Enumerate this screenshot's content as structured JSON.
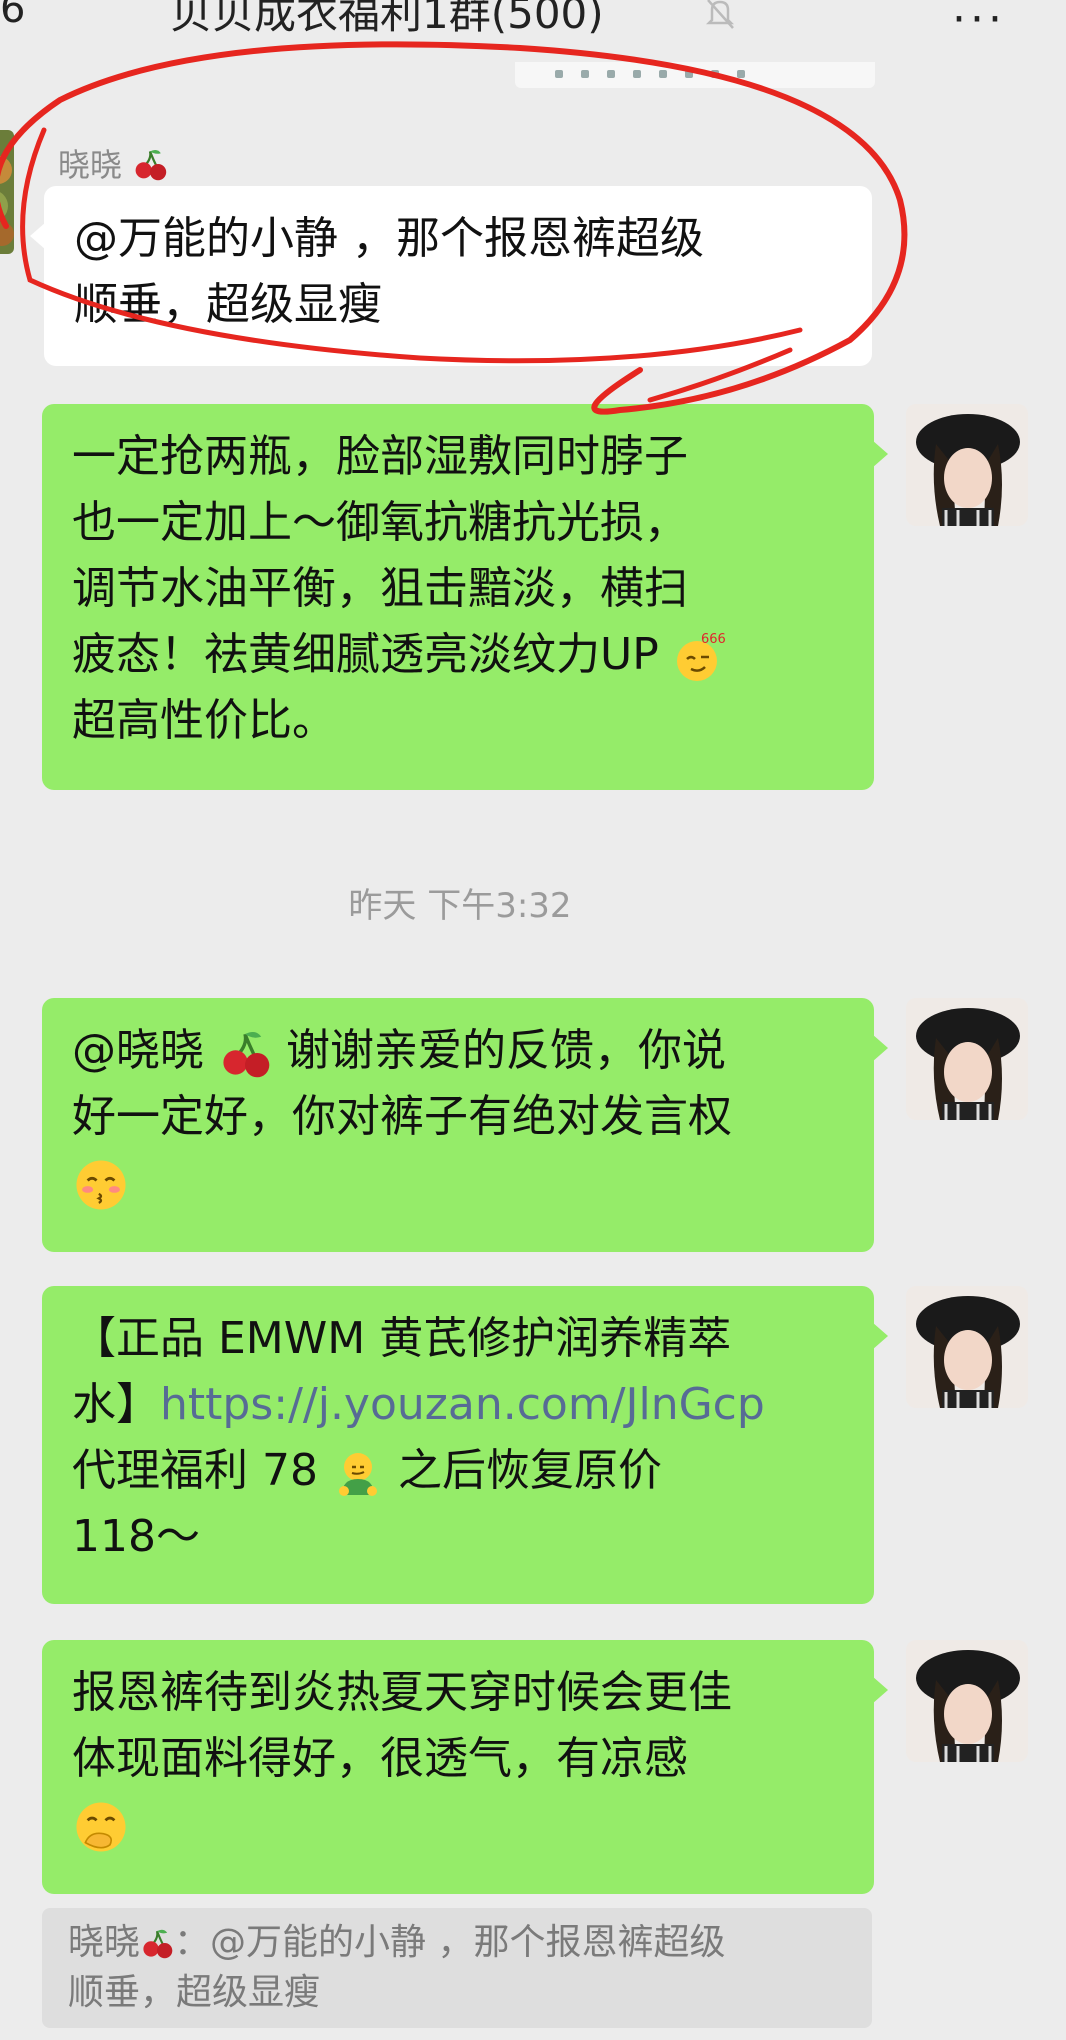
{
  "header": {
    "back_fragment": "6",
    "title": "贝贝成衣福利1群(500)",
    "mute_icon": "bell-slash-icon",
    "more_icon": "more-dots-icon",
    "more_label": "···"
  },
  "messages": [
    {
      "sender": "晓晓",
      "sender_emoji": "cherry-icon",
      "side": "left",
      "lines": [
        "@万能的小静 ，那个报恩裤超级",
        "顺垂，超级显瘦"
      ]
    },
    {
      "side": "right",
      "lines": [
        "一定抢两瓶，脸部湿敷同时脖子",
        "也一定加上～御氧抗糖抗光损，",
        "调节水油平衡，狙击黯淡，横扫",
        "疲态！祛黄细腻透亮淡纹力UP",
        "超高性价比。"
      ],
      "emoji": "666-face-icon",
      "emoji_badge": "666"
    },
    {
      "side": "right",
      "lines": [
        "@晓晓",
        "谢谢亲爱的反馈，你说",
        "好一定好，你对裤子有绝对发言权"
      ],
      "emoji": "kissing-face-icon"
    },
    {
      "side": "right",
      "lines": [
        "【正品 EMWM 黄芪修护润养精萃",
        "水】",
        "https://j.youzan.com/JlnGcp",
        "代理福利 78",
        "之后恢复原价",
        "118～"
      ],
      "emoji": "frog-smirk-icon"
    },
    {
      "side": "right",
      "lines": [
        "报恩裤待到炎热夏天穿时候会更佳",
        "体现面料得好，很透气，有凉感"
      ],
      "emoji": "hand-over-mouth-face-icon"
    }
  ],
  "timestamp": "昨天 下午3:32",
  "quote": {
    "sender": "晓晓",
    "line1": "：@万能的小静 ，那个报恩裤超级",
    "line2": "顺垂，超级显瘦"
  },
  "colors": {
    "background": "#ececec",
    "bubble_green": "#95ec69",
    "bubble_white": "#ffffff",
    "link": "#576b95",
    "annotation_red": "#e6261f"
  }
}
